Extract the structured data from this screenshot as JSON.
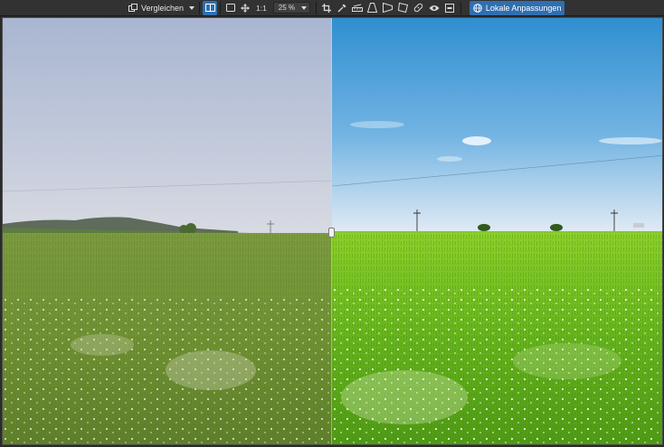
{
  "toolbar": {
    "compare_label": "Vergleichen",
    "one_to_one_label": "1:1",
    "zoom_value": "25 %",
    "local_adjustments_label": "Lokale Anpassungen"
  },
  "colors": {
    "toolbar_bg": "#323232",
    "accent": "#2f6fb0",
    "canvas_border": "#4b4b4b"
  },
  "icons": [
    "compare-icon",
    "dropdown-caret-icon",
    "split-view-icon",
    "single-view-icon",
    "move-icon",
    "zoom-dropdown-icon",
    "crop-icon",
    "eyedropper-icon",
    "straighten-icon",
    "perspective-vertical-icon",
    "perspective-horizontal-icon",
    "perspective-free-icon",
    "healing-icon",
    "preview-eye-icon",
    "before-after-toggle-icon",
    "local-adjustments-icon"
  ]
}
